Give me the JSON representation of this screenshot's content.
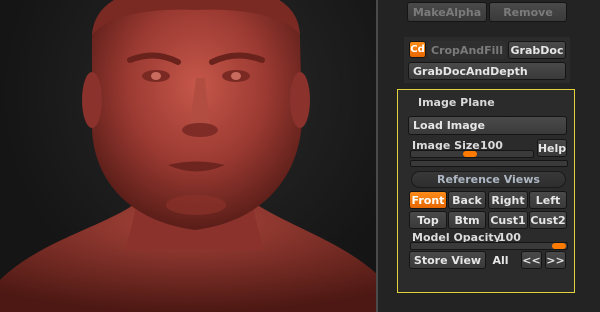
{
  "viewport": {
    "description_icon": "head-sculpt-icon",
    "material_color": "#9b3a32"
  },
  "top_buttons": {
    "make_alpha": "MakeAlpha",
    "remove": "Remove"
  },
  "crop_group": {
    "cd_toggle": "Cd",
    "crop_and_fill": "CropAndFill",
    "grab_doc": "GrabDoc",
    "grab_doc_and_depth": "GrabDocAndDepth"
  },
  "image_plane": {
    "title": "Image Plane",
    "load_image": "Load Image",
    "image_size_label": "Image Size",
    "image_size_value": "100",
    "help": "Help",
    "reference_views": "Reference Views",
    "views": [
      "Front",
      "Back",
      "Right",
      "Left",
      "Top",
      "Btm",
      "Cust1",
      "Cust2"
    ],
    "model_opacity_label": "Model Opacity",
    "model_opacity_value": "100",
    "store_view": "Store View",
    "all": "All",
    "prev": "<<",
    "next": ">>"
  },
  "colors": {
    "accent": "#ff7a00",
    "highlight_border": "#e2d23c"
  }
}
